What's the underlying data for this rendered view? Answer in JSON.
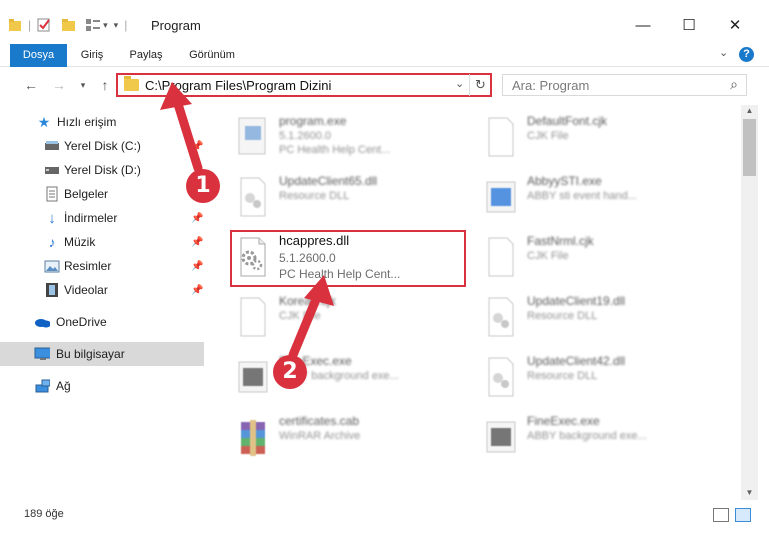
{
  "window": {
    "title": "Program",
    "minimize_label": "—",
    "maximize_label": "☐",
    "close_label": "✕"
  },
  "ribbon": {
    "tabs": [
      "Dosya",
      "Giriş",
      "Paylaş",
      "Görünüm"
    ],
    "help_label": "?"
  },
  "nav": {
    "address_path": "C:\\Program Files\\Program Dizini",
    "search_placeholder": "Ara: Program"
  },
  "sidebar": {
    "items": [
      {
        "label": "Hızlı erişim",
        "icon": "star-icon"
      },
      {
        "label": "Yerel Disk (C:)",
        "icon": "drive-icon"
      },
      {
        "label": "Yerel Disk (D:)",
        "icon": "drive-icon"
      },
      {
        "label": "Belgeler",
        "icon": "documents-icon"
      },
      {
        "label": "İndirmeler",
        "icon": "download-icon"
      },
      {
        "label": "Müzik",
        "icon": "music-icon"
      },
      {
        "label": "Resimler",
        "icon": "pictures-icon"
      },
      {
        "label": "Videolar",
        "icon": "videos-icon"
      },
      {
        "label": "OneDrive",
        "icon": "cloud-icon"
      },
      {
        "label": "Bu bilgisayar",
        "icon": "computer-icon"
      },
      {
        "label": "Ağ",
        "icon": "network-icon"
      }
    ]
  },
  "files": [
    {
      "name": "program.exe",
      "line2": "5.1.2600.0",
      "line3": "PC Health Help Cent..."
    },
    {
      "name": "DefaultFont.cjk",
      "line2": "CJK File",
      "line3": ""
    },
    {
      "name": "UpdateClient65.dll",
      "line2": "Resource DLL",
      "line3": ""
    },
    {
      "name": "AbbyySTI.exe",
      "line2": "ABBY sti event hand...",
      "line3": ""
    },
    {
      "name": "hcappres.dll",
      "line2": "5.1.2600.0",
      "line3": "PC Health Help Cent..."
    },
    {
      "name": "FastNrml.cjk",
      "line2": "CJK File",
      "line3": ""
    },
    {
      "name": "Korean.cjk",
      "line2": "CJK File",
      "line3": ""
    },
    {
      "name": "UpdateClient19.dll",
      "line2": "Resource DLL",
      "line3": ""
    },
    {
      "name": "FineExec.exe",
      "line2": "ABBY background exe...",
      "line3": ""
    },
    {
      "name": "UpdateClient42.dll",
      "line2": "Resource DLL",
      "line3": ""
    },
    {
      "name": "certificates.cab",
      "line2": "WinRAR Archive",
      "line3": ""
    },
    {
      "name": "FineExec.exe",
      "line2": "ABBY background exe...",
      "line3": ""
    }
  ],
  "status": {
    "item_count": "189 öğe"
  },
  "annotations": {
    "marker_1": "1",
    "marker_2": "2"
  },
  "colors": {
    "accent": "#1979ca",
    "highlight_red": "#d9323e"
  }
}
